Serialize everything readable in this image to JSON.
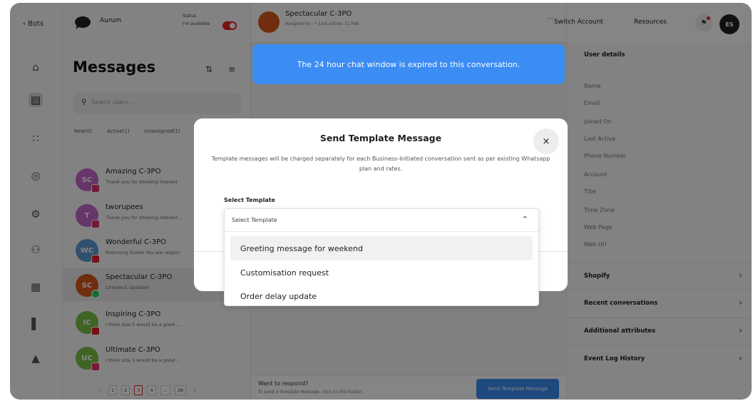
{
  "nav": {
    "back_label": "‹ Bots"
  },
  "rail": {
    "icons": [
      "home-icon",
      "messages-icon",
      "flow-icon",
      "bulb-icon",
      "settings-icon",
      "users-icon",
      "grid-icon",
      "chart-icon",
      "megaphone-icon"
    ]
  },
  "brand": {
    "name": "Aurum",
    "status_label": "Status",
    "status_value": "I'm available"
  },
  "messages": {
    "title": "Messages",
    "search_placeholder": "Search users...",
    "tabs": [
      "New(0)",
      "Active(1)",
      "Unassigned(1)"
    ],
    "conversations": [
      {
        "initials": "SC",
        "name": "Amazing C-3PO",
        "preview": "Thank you for showing interest",
        "color": "#c466c9",
        "channel": "instagram"
      },
      {
        "initials": "T",
        "name": "tworupees",
        "preview": "Thank you for showing interest...",
        "color": "#c466c9",
        "channel": "instagram"
      },
      {
        "initials": "WC",
        "name": "Wonderful C-3PO",
        "preview": "Returning Goods You are respon",
        "color": "#5a9bd4",
        "channel": "messenger"
      },
      {
        "initials": "SC",
        "name": "Spectacular C-3PO",
        "preview": "Checkout Updated",
        "color": "#d8581c",
        "channel": "whatsapp"
      },
      {
        "initials": "IC",
        "name": "Inspiring C-3PO",
        "preview": "I think size S would be a good ...",
        "color": "#7bc043",
        "channel": "messenger"
      },
      {
        "initials": "UC",
        "name": "Ultimate C-3PO",
        "preview": "I think size S would be a good ...",
        "color": "#7bc043",
        "channel": "instagram"
      }
    ],
    "pagination": [
      "‹",
      "1",
      "2",
      "3",
      "4",
      "...",
      "36",
      "›"
    ],
    "current_page": "3"
  },
  "chat": {
    "contact_name": "Spectacular C-3PO",
    "contact_sub": "Assigned to - • Last active: 11 Feb",
    "expired_notice": "The 24 hour chat window is expired to this conversation.",
    "respond_title": "Want to respond?",
    "respond_sub": "To send a Template Message, click on the button",
    "send_button": "Send Template Message"
  },
  "header": {
    "switch_account": "Switch Account",
    "resources": "Resources",
    "user_initials": "ES"
  },
  "user_details": {
    "title": "User details",
    "fields": [
      "Name",
      "Email",
      "Joined On",
      "Last Active",
      "Phone Number",
      "Account",
      "Title",
      "Time Zone",
      "Web Page",
      "Web Url"
    ],
    "sections": [
      "Shopify",
      "Recent conversations",
      "Additional attributes",
      "Event Log History"
    ]
  },
  "modal": {
    "title": "Send Template Message",
    "close": "×",
    "description": "Template messages will be charged separately for each Business-Initiated conversation sent as per existing Whatsapp plan and rates.",
    "select_label": "Select Template",
    "select_placeholder": "Select Template",
    "options": [
      "Greeting message for weekend",
      "Customisation request",
      "Order delay update"
    ]
  },
  "colors": {
    "accent": "#3b8cf3",
    "danger": "#e8202a",
    "highlight": "#f1f1f1"
  }
}
